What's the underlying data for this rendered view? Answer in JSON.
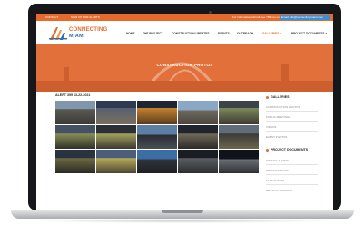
{
  "topbar": {
    "contact": "CONTACT",
    "sign_up": "SIGN UP FOR ALERTS",
    "phone_text": "For information call toll-free 786-xxx-xxxx",
    "email_text": "Email: info@connectingmiami.com"
  },
  "logo": {
    "line1": "CONNECTING",
    "line2": "MIAMI"
  },
  "nav": [
    {
      "label": "HOME"
    },
    {
      "label": "THE PROJECT"
    },
    {
      "label": "CONSTRUCTION UPDATES"
    },
    {
      "label": "EVENTS"
    },
    {
      "label": "OUTREACH"
    },
    {
      "label": "GALLERIES",
      "active": true,
      "dropdown": true
    },
    {
      "label": "PROJECT DOCUMENTS",
      "dropdown": true
    }
  ],
  "hero": {
    "title": "CONSTRUCTION PHOTOS"
  },
  "main": {
    "alert_title": "ALERT 395 13-22-2021"
  },
  "sidebar": {
    "galleries": {
      "heading": "GALLERIES",
      "items": [
        {
          "label": "CONSTRUCTION PHOTOS"
        },
        {
          "label": "PUBLIC MEETINGS"
        },
        {
          "label": "VIDEOS"
        },
        {
          "label": "EVENT PHOTOS"
        }
      ]
    },
    "documents": {
      "heading": "PROJECT DOCUMENTS",
      "items": [
        {
          "label": "TRAFFIC ALERTS"
        },
        {
          "label": "PRESENTATIONS"
        },
        {
          "label": "FACT SHEETS"
        },
        {
          "label": "PROJECT REPORTS"
        }
      ]
    }
  },
  "colors": {
    "accent": "#e56a2c",
    "email_bg": "#3a8fd6",
    "frame": "#15171a"
  }
}
